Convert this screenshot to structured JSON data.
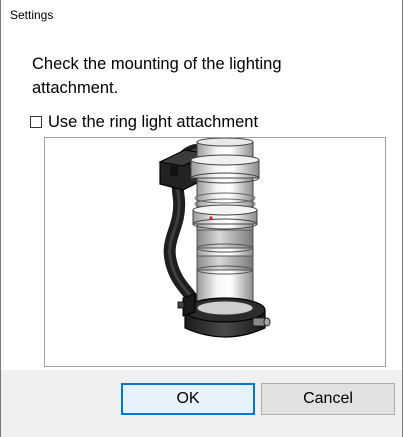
{
  "window": {
    "title": "Settings"
  },
  "dialog": {
    "message": "Check the mounting of the lighting attachment.",
    "checkbox": {
      "label": "Use the ring light attachment",
      "checked": false
    },
    "image_icon": "microscope-ring-light-illustration"
  },
  "buttons": {
    "ok_label": "OK",
    "cancel_label": "Cancel"
  },
  "colors": {
    "accent": "#0078d7",
    "footer_bg": "#f0f0f0"
  }
}
